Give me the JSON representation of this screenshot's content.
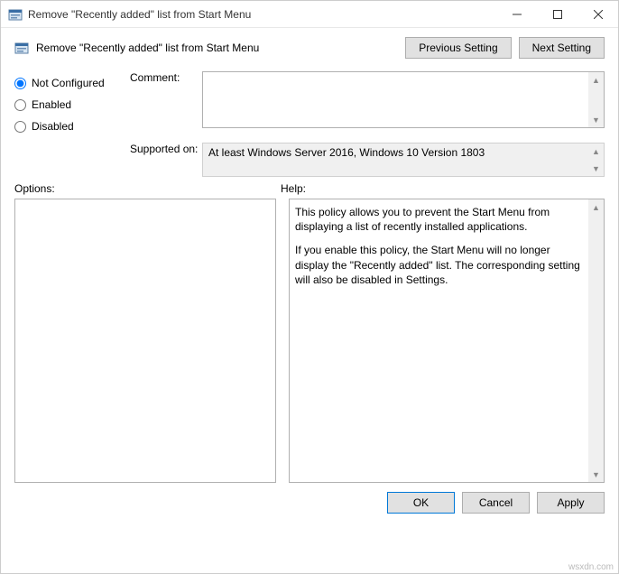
{
  "window": {
    "title": "Remove \"Recently added\" list from Start Menu"
  },
  "header": {
    "title": "Remove \"Recently added\" list from Start Menu",
    "prev_label": "Previous Setting",
    "next_label": "Next Setting"
  },
  "state_radios": {
    "not_configured": "Not Configured",
    "enabled": "Enabled",
    "disabled": "Disabled",
    "selected": "not_configured"
  },
  "fields": {
    "comment_label": "Comment:",
    "comment_value": "",
    "supported_label": "Supported on:",
    "supported_value": "At least Windows Server 2016, Windows 10 Version 1803"
  },
  "section_labels": {
    "options": "Options:",
    "help": "Help:"
  },
  "help": {
    "p1": "This policy allows you to prevent the Start Menu from displaying a list of recently installed applications.",
    "p2": "If you enable this policy, the Start Menu will no longer display the \"Recently added\" list.  The corresponding setting will also be disabled in Settings."
  },
  "footer": {
    "ok": "OK",
    "cancel": "Cancel",
    "apply": "Apply"
  },
  "watermark": "wsxdn.com"
}
